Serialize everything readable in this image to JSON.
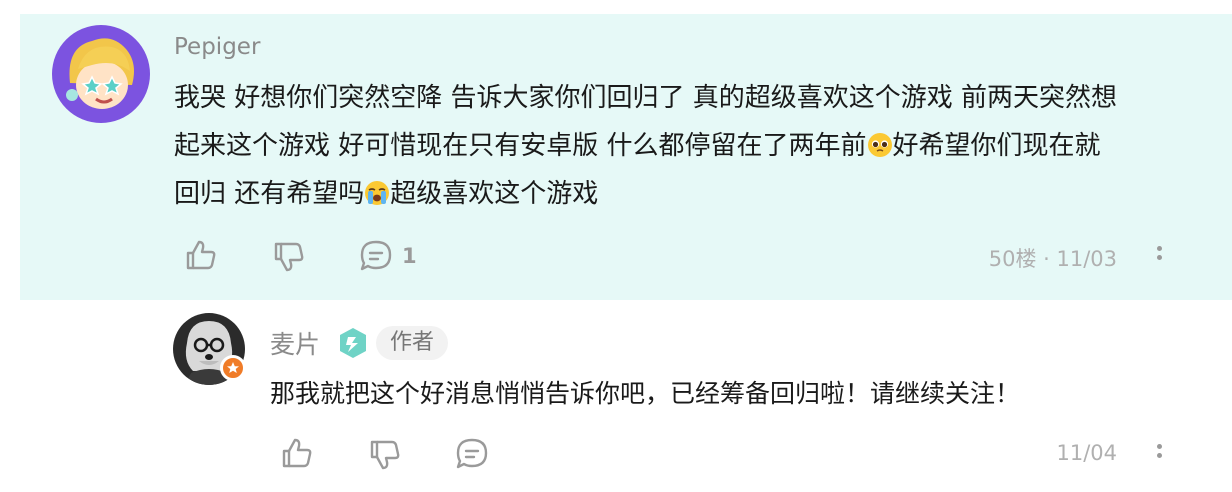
{
  "comment": {
    "author": "Pepiger",
    "text_line1": "我哭 好想你们突然空降 告诉大家你们回归了 真的超级喜欢这个游戏 前两天突然想",
    "text_line2a": "起来这个游戏 好可惜现在只有安卓版 什么都停留在了两年前",
    "text_line2b": "好希望你们现在就",
    "text_line3a": "回归 还有希望吗",
    "text_line3b": "超级喜欢这个游戏",
    "emoji_1": "pleading-face-emoji",
    "emoji_2": "loudly-crying-face-emoji",
    "reply_count": "1",
    "floor_date": "50楼 · 11/03"
  },
  "reply": {
    "author": "麦片",
    "author_tag": "作者",
    "text": "那我就把这个好消息悄悄告诉你吧，已经筹备回归啦！请继续关注！",
    "date": "11/04"
  },
  "icons": {
    "like": "thumbs-up-icon",
    "dislike": "thumbs-down-icon",
    "reply": "comment-bubble-icon",
    "more": "more-vertical-icon"
  },
  "colors": {
    "highlight_background": "#e6f9f7",
    "muted_text": "#8a8a8a",
    "icon_gray": "#9a9a9a",
    "badge_orange": "#f07c28",
    "level_teal": "#6fd3c6"
  }
}
